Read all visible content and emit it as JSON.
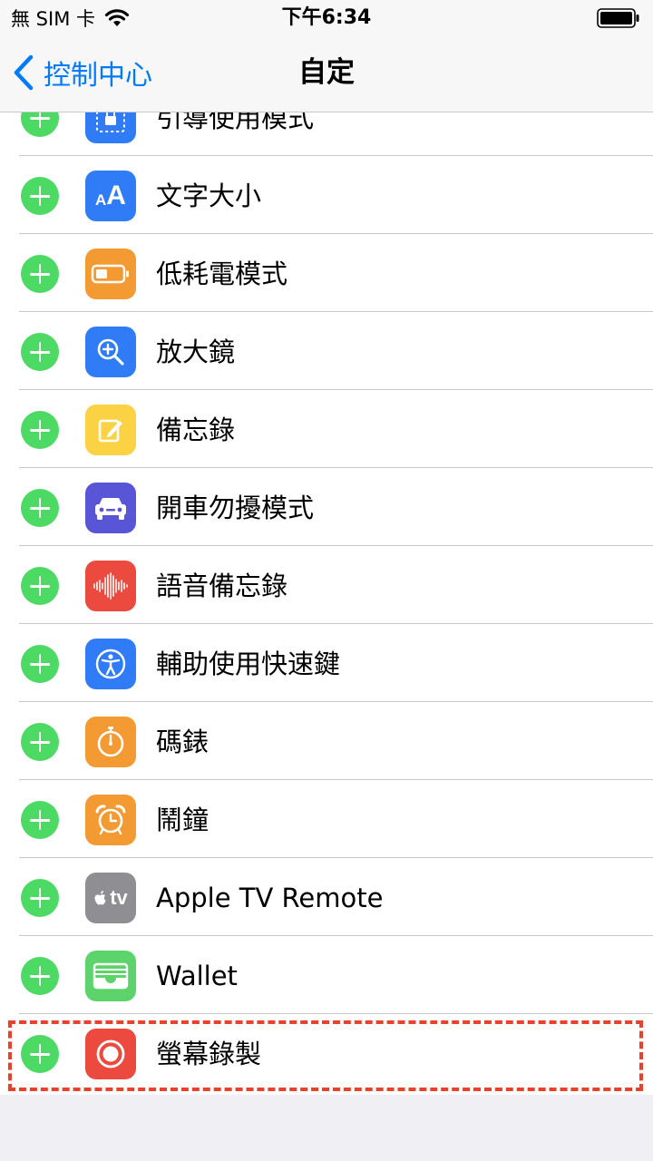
{
  "status_bar": {
    "carrier": "無 SIM 卡",
    "time": "下午6:34"
  },
  "nav": {
    "back_label": "控制中心",
    "title": "自定"
  },
  "items": [
    {
      "label": "引導使用模式",
      "icon": "guided-access-icon",
      "color": "#2f7cf6"
    },
    {
      "label": "文字大小",
      "icon": "text-size-icon",
      "color": "#2f7cf6"
    },
    {
      "label": "低耗電模式",
      "icon": "low-power-battery-icon",
      "color": "#f49a32"
    },
    {
      "label": "放大鏡",
      "icon": "magnifier-icon",
      "color": "#2f7cf6"
    },
    {
      "label": "備忘錄",
      "icon": "notes-icon",
      "color": "#fbd243"
    },
    {
      "label": "開車勿擾模式",
      "icon": "car-icon",
      "color": "#5856d6"
    },
    {
      "label": "語音備忘錄",
      "icon": "voice-memo-waveform-icon",
      "color": "#ec4a3f"
    },
    {
      "label": "輔助使用快速鍵",
      "icon": "accessibility-icon",
      "color": "#2f7cf6"
    },
    {
      "label": "碼錶",
      "icon": "stopwatch-icon",
      "color": "#f49a32"
    },
    {
      "label": "鬧鐘",
      "icon": "alarm-clock-icon",
      "color": "#f49a32"
    },
    {
      "label": "Apple TV Remote",
      "icon": "apple-tv-icon",
      "color": "#8e8e93"
    },
    {
      "label": "Wallet",
      "icon": "wallet-icon",
      "color": "#5dd36c"
    },
    {
      "label": "螢幕錄製",
      "icon": "screen-record-icon",
      "color": "#ec4a3f"
    }
  ],
  "icon_glyphs": {
    "text_size_small": "A",
    "text_size_large": "A",
    "apple_tv": "tv"
  }
}
